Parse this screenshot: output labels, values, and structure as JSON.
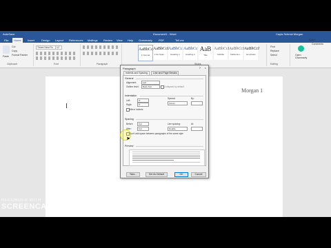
{
  "window": {
    "title": "Document1 - Word",
    "autosave": "AutoSave",
    "user": "Cayla Schmid Morgan"
  },
  "tabs": [
    "File",
    "Home",
    "Insert",
    "Design",
    "Layout",
    "References",
    "Mailings",
    "Review",
    "View",
    "Help",
    "Grammarly",
    "PDF",
    "Tell me"
  ],
  "ribbon": {
    "paste": "Paste",
    "cut": "Cut",
    "copy": "Copy",
    "format_painter": "Format Painter",
    "clipboard_label": "Clipboard",
    "font_name": "Times New Ro",
    "font_size": "12",
    "font_label": "Font",
    "paragraph_label": "Paragraph",
    "styles_label": "Styles",
    "editing_label": "Editing",
    "find": "Find",
    "replace": "Replace",
    "select": "Select",
    "open_grammarly": "Open Grammarly",
    "share": "Share",
    "comments": "Comments",
    "styles": [
      {
        "sample": "AaBbCcI",
        "name": "1 Normal"
      },
      {
        "sample": "AaBbCcI",
        "name": "1 No Spac..."
      },
      {
        "sample": "AaBbCc",
        "name": "Heading 1"
      },
      {
        "sample": "AaBbCc",
        "name": "Heading 2"
      },
      {
        "sample": "AaB",
        "name": "Title"
      },
      {
        "sample": "AaBbCcI",
        "name": "Subtitle"
      },
      {
        "sample": "AaBbCcI",
        "name": "Subtle Em..."
      },
      {
        "sample": "AaBbCcI",
        "name": "Emphasis"
      }
    ]
  },
  "document": {
    "header_text": "Morgan 1"
  },
  "dialog": {
    "title": "Paragraph",
    "help": "?",
    "close": "×",
    "tabs": [
      "Indents and Spacing",
      "Line and Page Breaks"
    ],
    "general": {
      "heading": "General",
      "alignment_label": "Alignment:",
      "alignment_value": "Left",
      "outline_label": "Outline level:",
      "outline_value": "Body Text",
      "collapsed_label": "Collapsed by default"
    },
    "indentation": {
      "heading": "Indentation",
      "left_label": "Left:",
      "left_value": "0\"",
      "right_label": "Right:",
      "right_value": "0\"",
      "special_label": "Special:",
      "special_value": "(none)",
      "by_label": "By:",
      "mirror_label": "Mirror indents"
    },
    "spacing": {
      "heading": "Spacing",
      "before_label": "Before:",
      "before_value": "0 pt",
      "after_label": "After:",
      "after_value": "0 pt",
      "line_label": "Line spacing:",
      "line_value": "Double",
      "at_label": "At:",
      "dont_add_label": "Don't add space between paragraphs of the same style"
    },
    "preview_heading": "Preview",
    "buttons": {
      "tabs": "Tabs...",
      "set_default": "Set As Default",
      "ok": "OK",
      "cancel": "Cancel"
    }
  },
  "watermark": {
    "recorded_with": "RECORDED WITH",
    "brand": "SCREENCAST-O-MATIC"
  }
}
